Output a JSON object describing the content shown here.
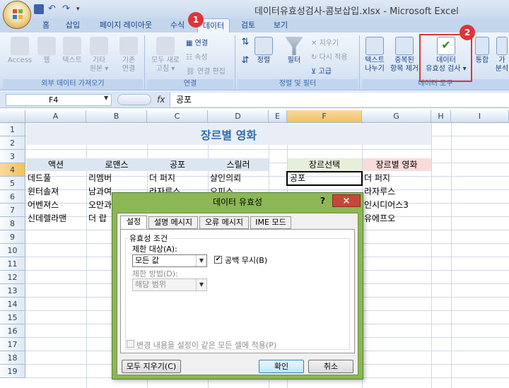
{
  "title_bar": {
    "text": "데이터유효성검사-콤보삽입.xlsx - Microsoft Excel"
  },
  "quick_access_icons": [
    "save-icon",
    "undo-icon",
    "redo-icon",
    "customize-icon"
  ],
  "tabs": [
    {
      "label": "홈"
    },
    {
      "label": "삽입"
    },
    {
      "label": "페이지 레이아웃"
    },
    {
      "label": "수식"
    },
    {
      "label": "데이터"
    },
    {
      "label": "검토"
    },
    {
      "label": "보기"
    }
  ],
  "active_tab": "데이터",
  "callouts": [
    "1",
    "2"
  ],
  "accent_color": "#e0343a",
  "ribbon": {
    "external": {
      "access": "Access",
      "web": "웹",
      "text": "텍스트",
      "other_line1": "기타",
      "other_line2": "원본 ▾",
      "existing_line1": "기존",
      "existing_line2": "연결",
      "group": "외부 데이터 가져오기"
    },
    "connections": {
      "refresh_line1": "모두 새로",
      "refresh_line2": "고침 ▾",
      "connections": "연결",
      "properties": "속성",
      "edit_links": "연결 편집",
      "group": "연결"
    },
    "sort_filter": {
      "sort": "정렬",
      "filter": "필터",
      "clear": "지우기",
      "reapply": "다시 적용",
      "advanced": "고급",
      "group": "정렬 및 필터"
    },
    "data_tools": {
      "text_to_cols_line1": "텍스트",
      "text_to_cols_line2": "나누기",
      "remove_dup_line1": "중복된",
      "remove_dup_line2": "항목 제거",
      "validation_line1": "데이터",
      "validation_line2": "유효성 검사 ▾",
      "consolidate": "통합",
      "whatif_line1": "가",
      "whatif_line2": "분석",
      "group": "데이터 도구"
    }
  },
  "formula_bar": {
    "name_box": "F4",
    "fx": "fx",
    "value": "공포"
  },
  "columns": [
    "A",
    "B",
    "C",
    "D",
    "E",
    "F",
    "G",
    "H",
    "I"
  ],
  "rows": [
    "1",
    "2",
    "3",
    "4",
    "5",
    "6",
    "7",
    "8",
    "9",
    "10",
    "11",
    "12",
    "13",
    "14",
    "15",
    "16",
    "17",
    "18",
    "19"
  ],
  "sheet": {
    "title": "장르별 영화",
    "headers": [
      "액션",
      "로맨스",
      "공포",
      "스릴러"
    ],
    "data": [
      [
        "데드풀",
        "리멤버",
        "더 퍼지",
        "살인의뢰"
      ],
      [
        "윈터솔져",
        "남과여",
        "라자루스",
        "오피스"
      ],
      [
        "어벤져스",
        "오만과",
        "",
        ""
      ],
      [
        "신데렐라맨",
        "더 랍",
        "",
        ""
      ]
    ],
    "select_label": "장르선택",
    "select_value": "공포",
    "result_label": "장르별 영화",
    "result_values": [
      "더 퍼지",
      "라자루스",
      "인시디어스3",
      "유에프오"
    ]
  },
  "dialog": {
    "title": "데이터 유효성",
    "help": "?",
    "close": "×",
    "tabs": [
      "설정",
      "설명 메시지",
      "오류 메시지",
      "IME 모드"
    ],
    "group_label": "유효성 조건",
    "allow_label": "제한 대상(A):",
    "allow_value": "모든 값",
    "ignore_blank_label": "공백 무시(B)",
    "data_label": "제한 방법(D):",
    "data_value": "해당 범위",
    "apply_all_label": "변경 내용을 설정이 같은 모든 셀에 적용(P)",
    "clear_all": "모두 지우기(C)",
    "ok": "확인",
    "cancel": "취소"
  }
}
